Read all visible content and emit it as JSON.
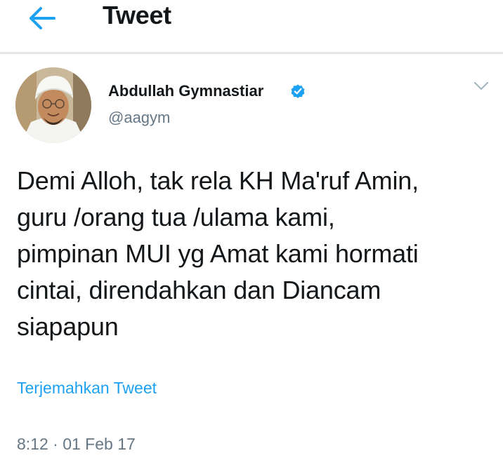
{
  "header": {
    "title": "Tweet",
    "back_icon": "arrow-left-icon"
  },
  "tweet": {
    "author": {
      "name": "Abdullah Gymnastiar",
      "handle": "@aagym",
      "verified": true,
      "verified_icon": "verified-badge-icon"
    },
    "menu_icon": "chevron-down-icon",
    "text": "Demi Alloh, tak rela KH Ma'ruf Amin,\nguru /orang tua /ulama kami,\npimpinan MUI yg Amat kami hormati\ncintai, direndahkan dan Diancam\nsiapapun",
    "translate_label": "Terjemahkan Tweet",
    "timestamp": "8:12 · 01 Feb 17"
  },
  "colors": {
    "accent": "#1da1f2",
    "secondary_text": "#657786",
    "primary_text": "#14171a",
    "divider": "#e4e6e8"
  }
}
